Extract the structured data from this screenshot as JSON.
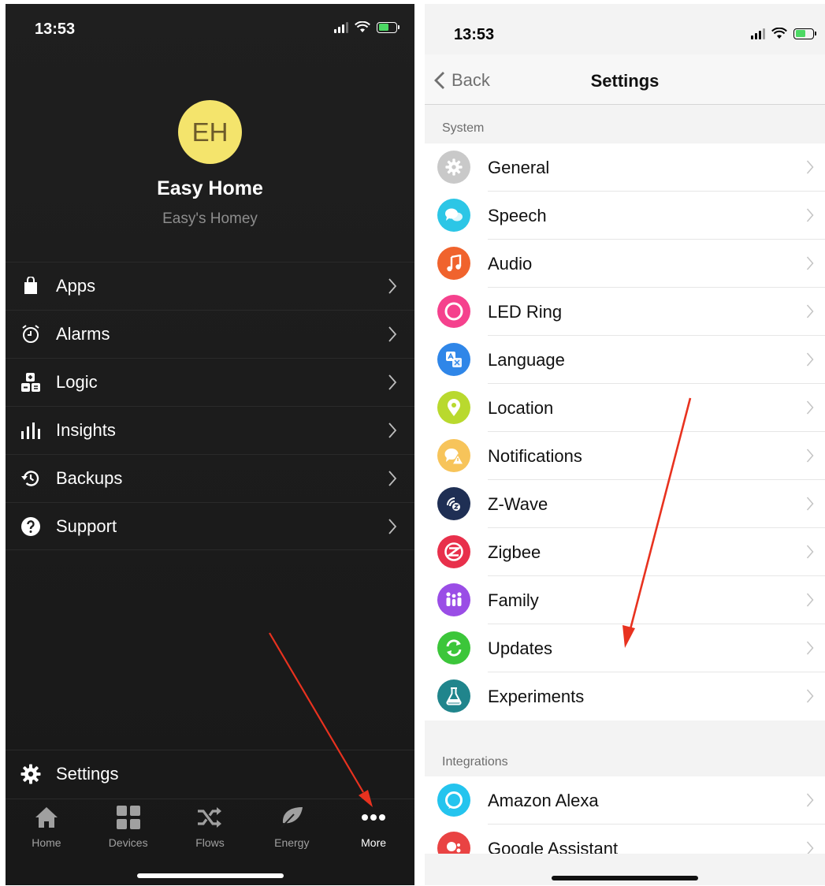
{
  "left": {
    "status_time": "13:53",
    "avatar_initials": "EH",
    "profile_name": "Easy Home",
    "profile_subtitle": "Easy's Homey",
    "menu": [
      {
        "label": "Apps",
        "icon": "shopping-bag-icon"
      },
      {
        "label": "Alarms",
        "icon": "alarm-clock-icon"
      },
      {
        "label": "Logic",
        "icon": "logic-blocks-icon"
      },
      {
        "label": "Insights",
        "icon": "bar-chart-icon"
      },
      {
        "label": "Backups",
        "icon": "history-icon"
      },
      {
        "label": "Support",
        "icon": "question-circle-icon"
      }
    ],
    "settings_label": "Settings",
    "tabs": [
      {
        "label": "Home",
        "icon": "home-icon"
      },
      {
        "label": "Devices",
        "icon": "grid-icon"
      },
      {
        "label": "Flows",
        "icon": "shuffle-icon"
      },
      {
        "label": "Energy",
        "icon": "leaf-icon"
      },
      {
        "label": "More",
        "icon": "more-dots-icon",
        "active": true
      }
    ]
  },
  "right": {
    "status_time": "13:53",
    "back_label": "Back",
    "title": "Settings",
    "system_header": "System",
    "system_items": [
      {
        "label": "General",
        "color": "#c9c9c9",
        "icon": "gear-icon"
      },
      {
        "label": "Speech",
        "color": "#2cc6e6",
        "icon": "speech-bubbles-icon"
      },
      {
        "label": "Audio",
        "color": "#f0632d",
        "icon": "music-note-icon"
      },
      {
        "label": "LED Ring",
        "color": "#f5418d",
        "icon": "ring-icon"
      },
      {
        "label": "Language",
        "color": "#2f86e8",
        "icon": "translate-icon"
      },
      {
        "label": "Location",
        "color": "#b9d92e",
        "icon": "map-pin-icon"
      },
      {
        "label": "Notifications",
        "color": "#f7c45a",
        "icon": "notification-warning-icon"
      },
      {
        "label": "Z-Wave",
        "color": "#1f2f54",
        "icon": "zwave-icon"
      },
      {
        "label": "Zigbee",
        "color": "#e8304b",
        "icon": "zigbee-icon"
      },
      {
        "label": "Family",
        "color": "#9a4de6",
        "icon": "family-icon"
      },
      {
        "label": "Updates",
        "color": "#3cc63a",
        "icon": "refresh-icon"
      },
      {
        "label": "Experiments",
        "color": "#20858c",
        "icon": "flask-icon"
      }
    ],
    "integrations_header": "Integrations",
    "integration_items": [
      {
        "label": "Amazon Alexa",
        "color": "#24c4ee",
        "icon": "alexa-icon"
      },
      {
        "label": "Google Assistant",
        "color": "#e94343",
        "icon": "google-assistant-icon"
      }
    ]
  },
  "colors": {
    "arrow": "#e8321f",
    "dark_bg": "#1c1c1c",
    "avatar": "#f4e46c"
  }
}
